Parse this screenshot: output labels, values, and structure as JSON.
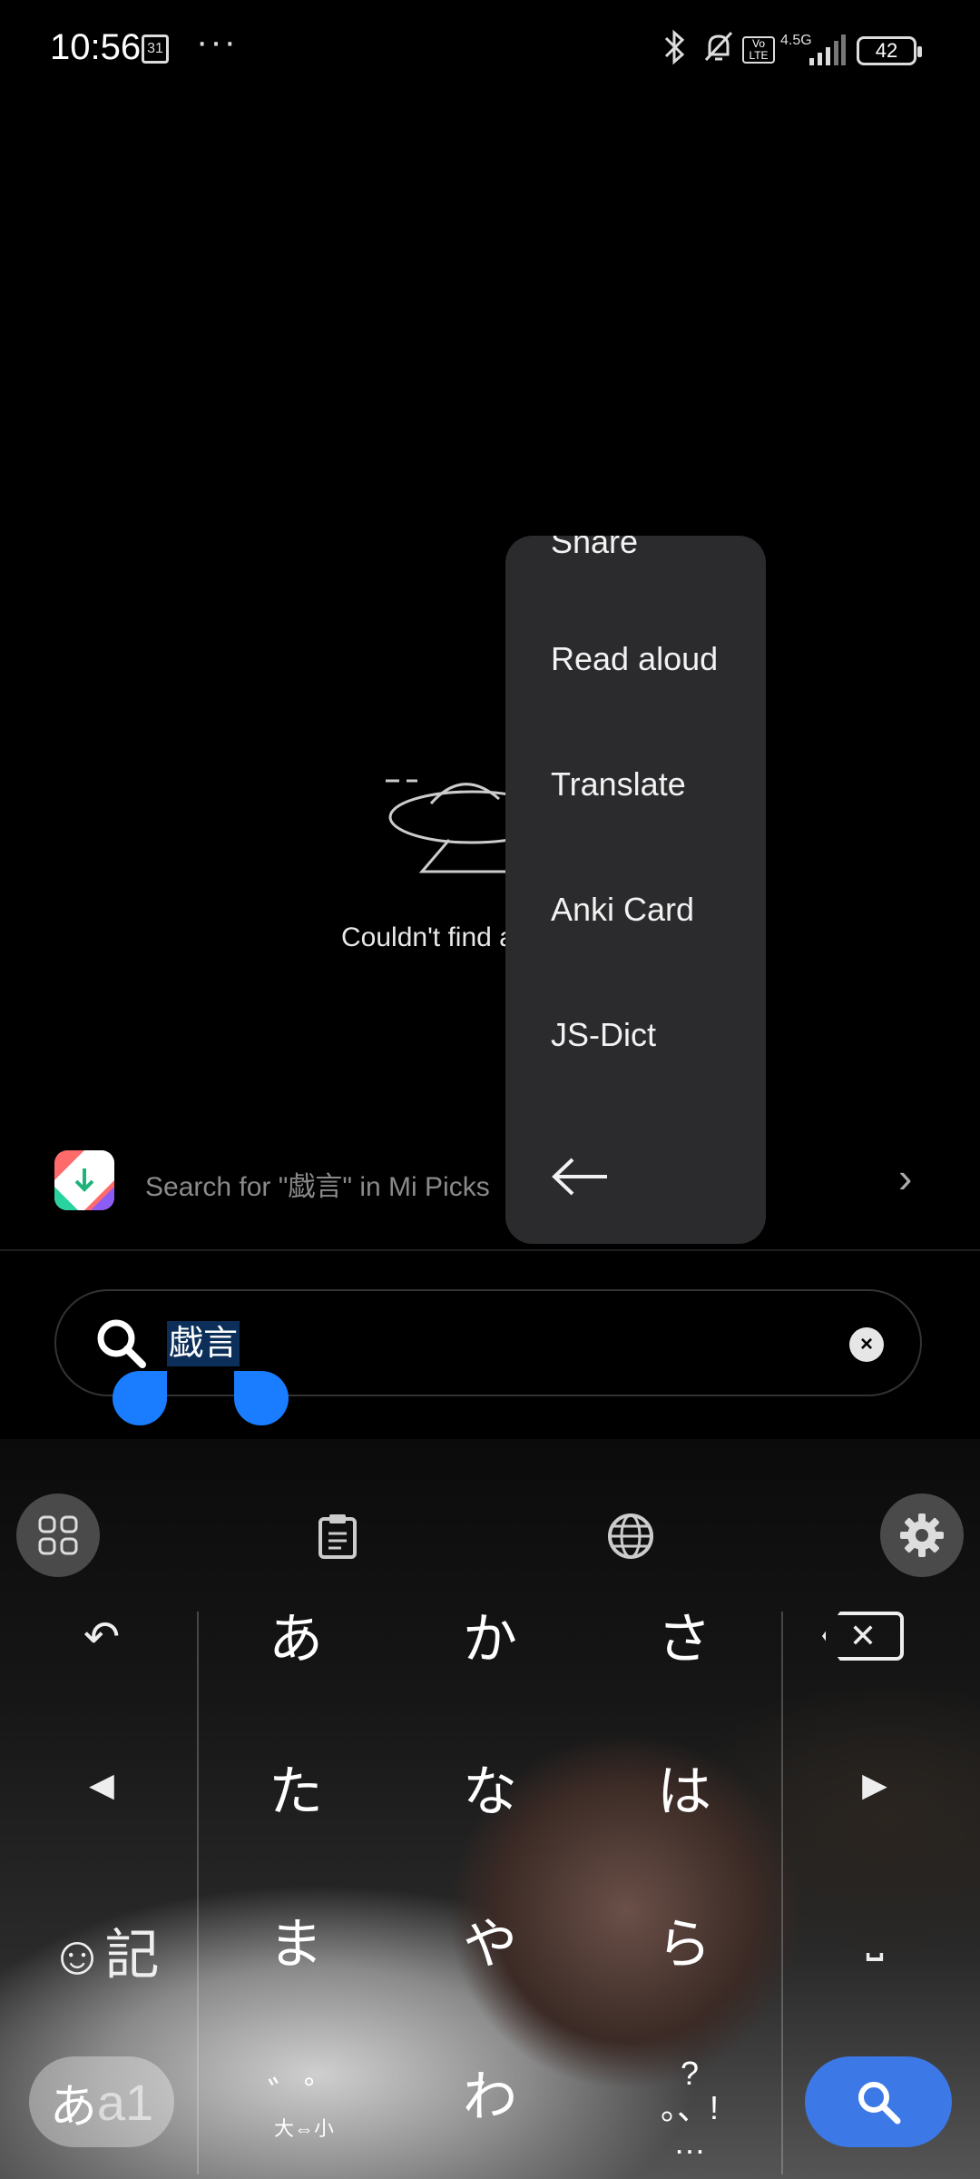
{
  "status_bar": {
    "time": "10:56",
    "calendar_day": "31",
    "more": "···",
    "network": "4.5G",
    "volte": "Vo LTE",
    "battery": "42"
  },
  "empty_state": {
    "message": "Couldn't find a"
  },
  "mipicks": {
    "text": "Search for \"戯言\" in Mi Picks",
    "chevron": "›"
  },
  "search": {
    "query": "戯言",
    "clear": "×"
  },
  "context_menu": {
    "items": [
      "Share",
      "Read aloud",
      "Translate",
      "Anki Card",
      "JS-Dict"
    ]
  },
  "keyboard": {
    "undo": "↶",
    "left": "◀",
    "right": "▶",
    "emoji": "☺記",
    "delete": "✕",
    "space": "⎵",
    "mode_main": "あ",
    "mode_sub": "a1",
    "dakuten": "゛゜",
    "dakuten_sub": "大⇔小",
    "punct_top": "?",
    "punct_mid": "。、!",
    "punct_bottom": "…",
    "rows": [
      [
        "あ",
        "か",
        "さ"
      ],
      [
        "た",
        "な",
        "は"
      ],
      [
        "ま",
        "や",
        "ら"
      ],
      [
        "",
        "わ",
        ""
      ]
    ]
  },
  "colors": {
    "accent": "#1a7cff",
    "search_key": "#3c78e6",
    "menu_bg": "#2b2b2d"
  }
}
